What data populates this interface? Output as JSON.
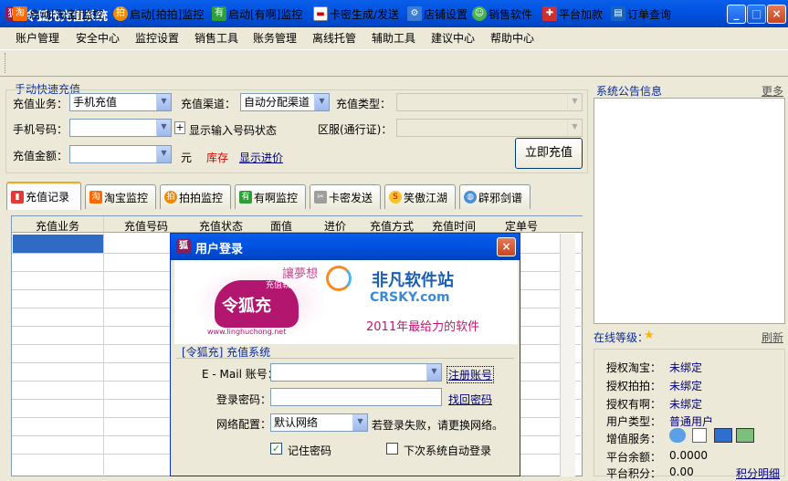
{
  "window": {
    "title": "令狐充充值系统"
  },
  "menu": [
    "账户管理",
    "安全中心",
    "监控设置",
    "销售工具",
    "账务管理",
    "离线托管",
    "辅助工具",
    "建议中心",
    "帮助中心"
  ],
  "toolbar": [
    "启动[淘宝]监控",
    "启动[拍拍]监控",
    "启动[有啊]监控",
    "卡密生成/发送",
    "店铺设置",
    "销售软件",
    "平台加款",
    "订单查询"
  ],
  "quick": {
    "section_title": "手动快速充值",
    "business_label": "充值业务：",
    "business_value": "手机充值",
    "channel_label": "充值渠道：",
    "channel_value": "自动分配渠道",
    "type_label": "充值类型：",
    "phone_label": "手机号码：",
    "show_status": "显示输入号码状态",
    "region_label": "区服(通行证)：",
    "amount_label": "充值金额：",
    "unit": "元",
    "stock": "库存",
    "show_price": "显示进价",
    "submit": "立即充值"
  },
  "tabs": [
    "充值记录",
    "淘宝监控",
    "拍拍监控",
    "有啊监控",
    "卡密发送",
    "笑傲江湖",
    "辟邪剑谱"
  ],
  "grid_headers": [
    "充值业务",
    "充值号码",
    "充值状态",
    "面值",
    "进价",
    "充值方式",
    "充值时间",
    "定单号"
  ],
  "side": {
    "notice_title": "系统公告信息",
    "more": "更多",
    "level_label": "在线等级：",
    "refresh": "刷新",
    "rows": [
      {
        "label": "授权淘宝：",
        "value": "未绑定"
      },
      {
        "label": "授权拍拍：",
        "value": "未绑定"
      },
      {
        "label": "授权有啊：",
        "value": "未绑定"
      },
      {
        "label": "用户类型：",
        "value": "普通用户"
      },
      {
        "label": "增值服务：",
        "value": ""
      },
      {
        "label": "平台余额：",
        "value": "0.0000"
      },
      {
        "label": "平台积分：",
        "value": "0.00"
      }
    ],
    "points_detail": "积分明细"
  },
  "login": {
    "title": "用户登录",
    "banner_slogan": "2011年最给力的软件",
    "banner_brand": "令狐充",
    "banner_brand_sub": "充值软件",
    "banner_url": "www.linghuchong.net",
    "banner_motto": "讓夢想",
    "watermark_cn": "非凡软件站",
    "watermark_en": "CRSKY.com",
    "system_label": "[令狐充] 充值系统",
    "email_label": "E - Mail 账号：",
    "register": "注册账号",
    "password_label": "登录密码：",
    "find_password": "找回密码",
    "network_label": "网络配置：",
    "network_value": "默认网络",
    "network_hint": "若登录失败，请更换网络。",
    "remember": "记住密码",
    "auto_login": "下次系统自动登录"
  }
}
